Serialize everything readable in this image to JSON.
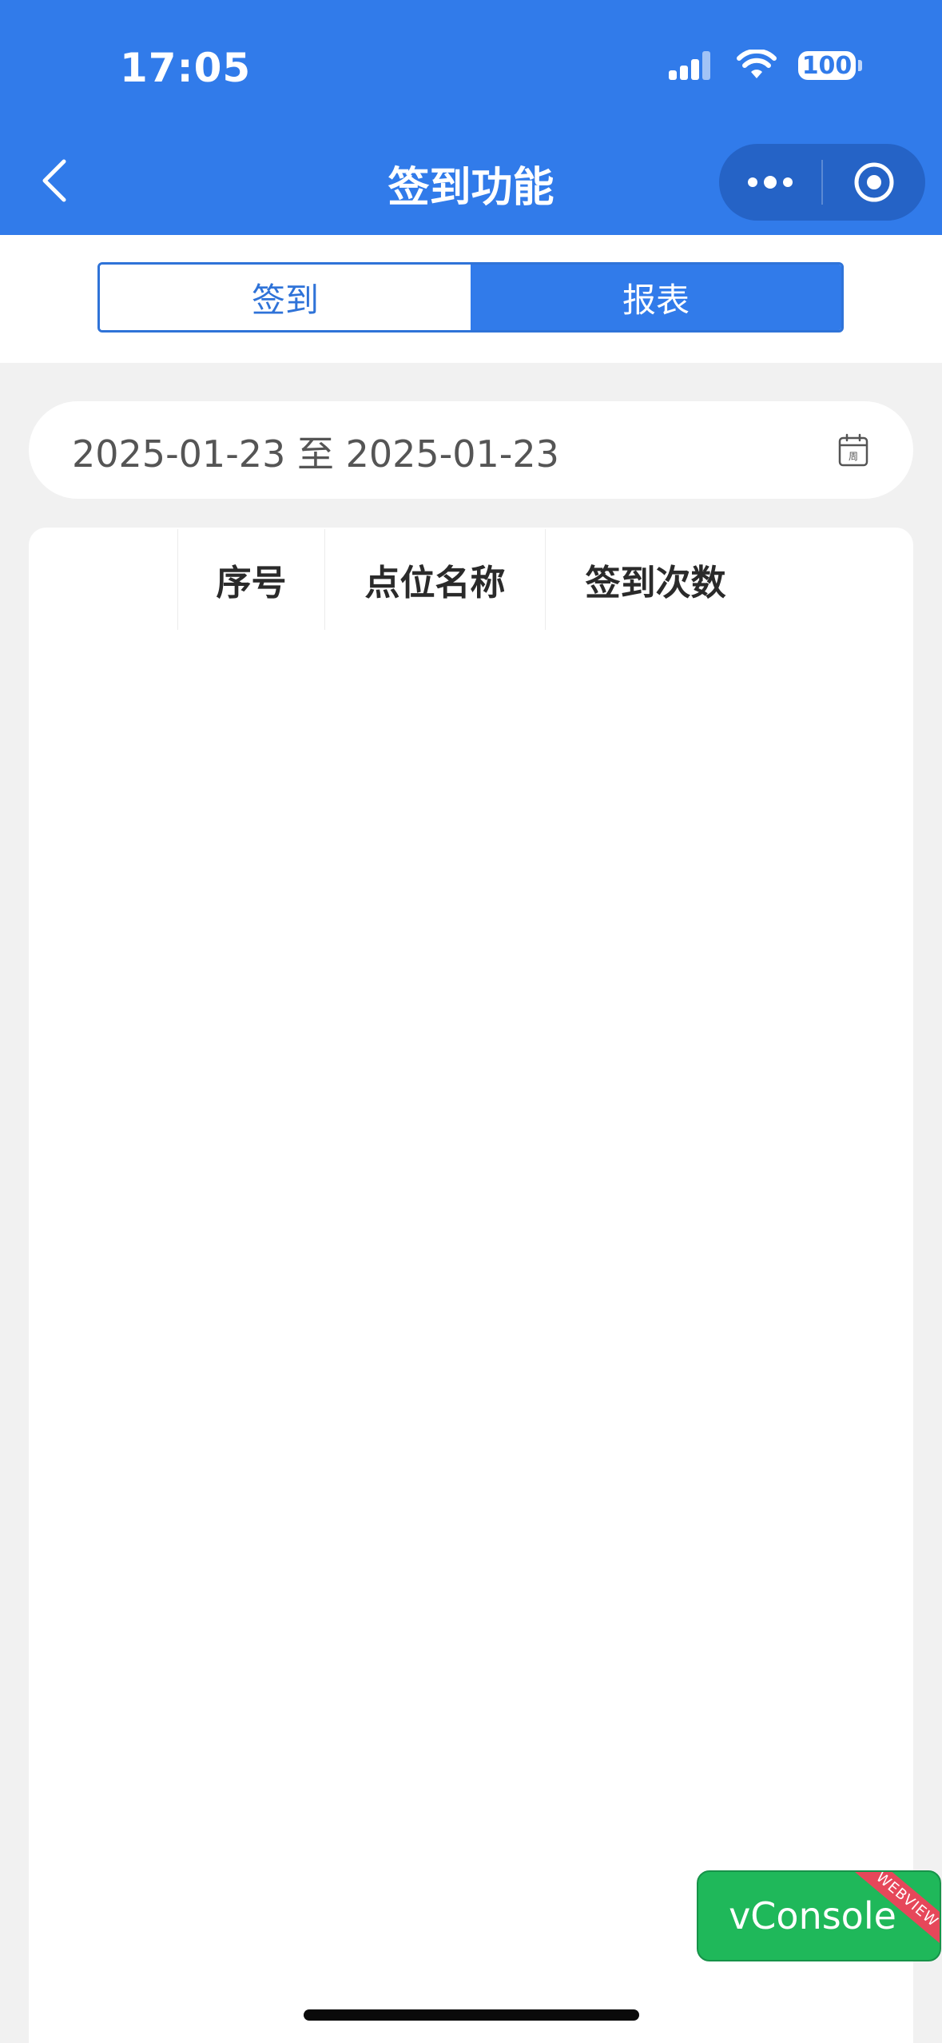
{
  "status_bar": {
    "time": "17:05",
    "battery": "100"
  },
  "nav": {
    "title": "签到功能"
  },
  "tabs": [
    {
      "label": "签到",
      "active": false
    },
    {
      "label": "报表",
      "active": true
    }
  ],
  "date_range": {
    "text": "2025-01-23 至 2025-01-23",
    "calendar_label": "周"
  },
  "table": {
    "columns": [
      "序号",
      "点位名称",
      "签到次数"
    ],
    "rows": []
  },
  "vconsole": {
    "label": "vConsole",
    "ribbon": "WEBVIEW"
  },
  "colors": {
    "primary": "#317bea",
    "vconsole_green": "#1fb85a",
    "ribbon_red": "#e6475a"
  }
}
